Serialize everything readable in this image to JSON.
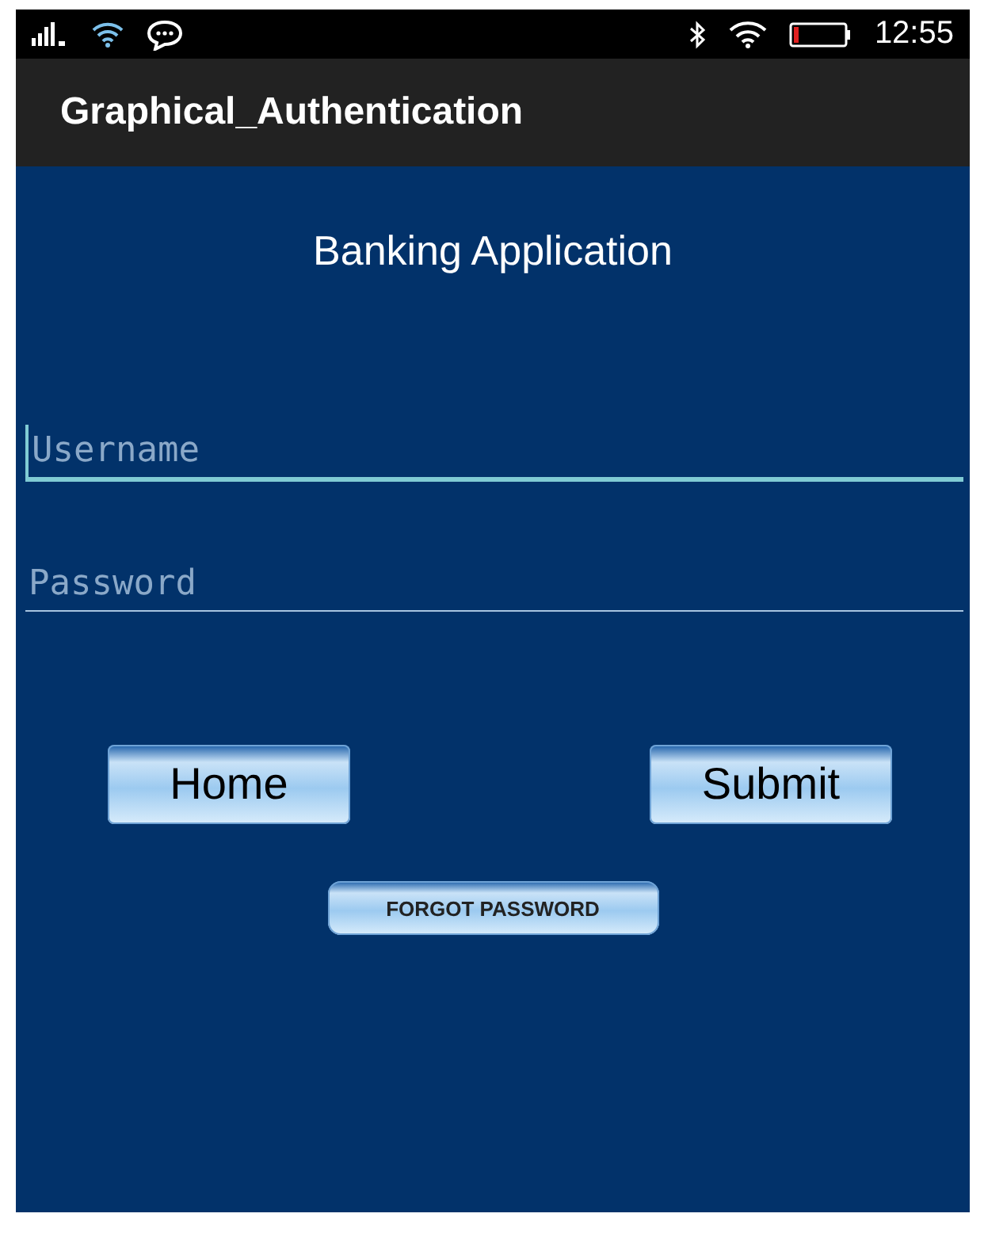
{
  "status_bar": {
    "time": "12:55"
  },
  "app_bar": {
    "title": "Graphical_Authentication"
  },
  "heading": "Banking Application",
  "fields": [
    {
      "placeholder": "Username",
      "focused": true
    },
    {
      "placeholder": "Password",
      "focused": false
    }
  ],
  "buttons": [
    {
      "label": "Home"
    },
    {
      "label": "Submit"
    }
  ],
  "link_button": {
    "label": "FORGOT PASSWORD"
  }
}
